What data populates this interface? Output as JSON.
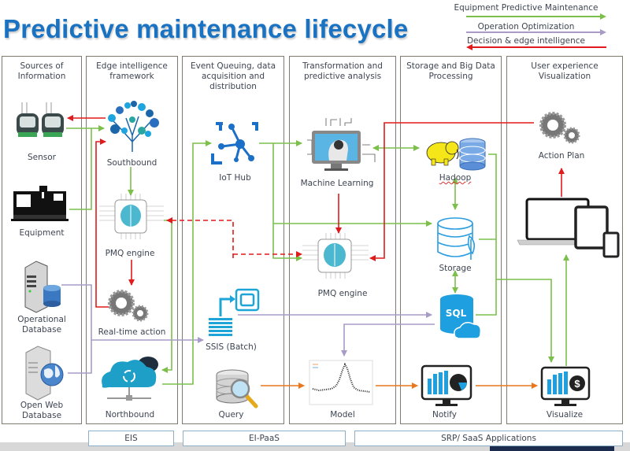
{
  "title": "Predictive maintenance lifecycle",
  "legend": [
    {
      "label": "Equipment Predictive Maintenance",
      "color": "#7cc04b",
      "direction": "right"
    },
    {
      "label": "Operation Optimization",
      "color": "#a99bc8",
      "direction": "right"
    },
    {
      "label": "Decision & edge intelligence",
      "color": "#e01b1b",
      "direction": "left"
    }
  ],
  "lanes": [
    {
      "title": "Sources of\nInformation"
    },
    {
      "title": "Edge intelligence\nframework"
    },
    {
      "title": "Event Queuing, data\nacquisition and\ndistribution"
    },
    {
      "title": "Transformation and\npredictive analysis"
    },
    {
      "title": "Storage and Big Data\nProcessing"
    },
    {
      "title": "User experience\nVisualization"
    }
  ],
  "nodes": {
    "sensor": "Sensor",
    "equipment": "Equipment",
    "operational_db": "Operational\nDatabase",
    "open_web_db": "Open Web\nDatabase",
    "southbound": "Southbound",
    "pmq_engine_edge": "PMQ engine",
    "realtime_action": "Real-time action",
    "northbound": "Northbound",
    "iot_hub": "IoT Hub",
    "ssis": "SSIS (Batch)",
    "query": "Query",
    "machine_learning": "Machine Learning",
    "pmq_engine_cloud": "PMQ engine",
    "model": "Model",
    "hadoop": "Hadoop",
    "storage": "Storage",
    "sql": "SQL",
    "notify": "Notify",
    "action_plan": "Action Plan",
    "visualize": "Visualize"
  },
  "footer": [
    {
      "label": "EIS"
    },
    {
      "label": "EI-PaaS"
    },
    {
      "label": "SRP/ SaaS Applications"
    }
  ],
  "colors": {
    "title": "#1a73c2",
    "green_flow": "#7cc04b",
    "purple_flow": "#a99bc8",
    "red_flow": "#e01b1b",
    "orange_flow": "#e8771e",
    "icon_blue": "#1e9fe0"
  }
}
